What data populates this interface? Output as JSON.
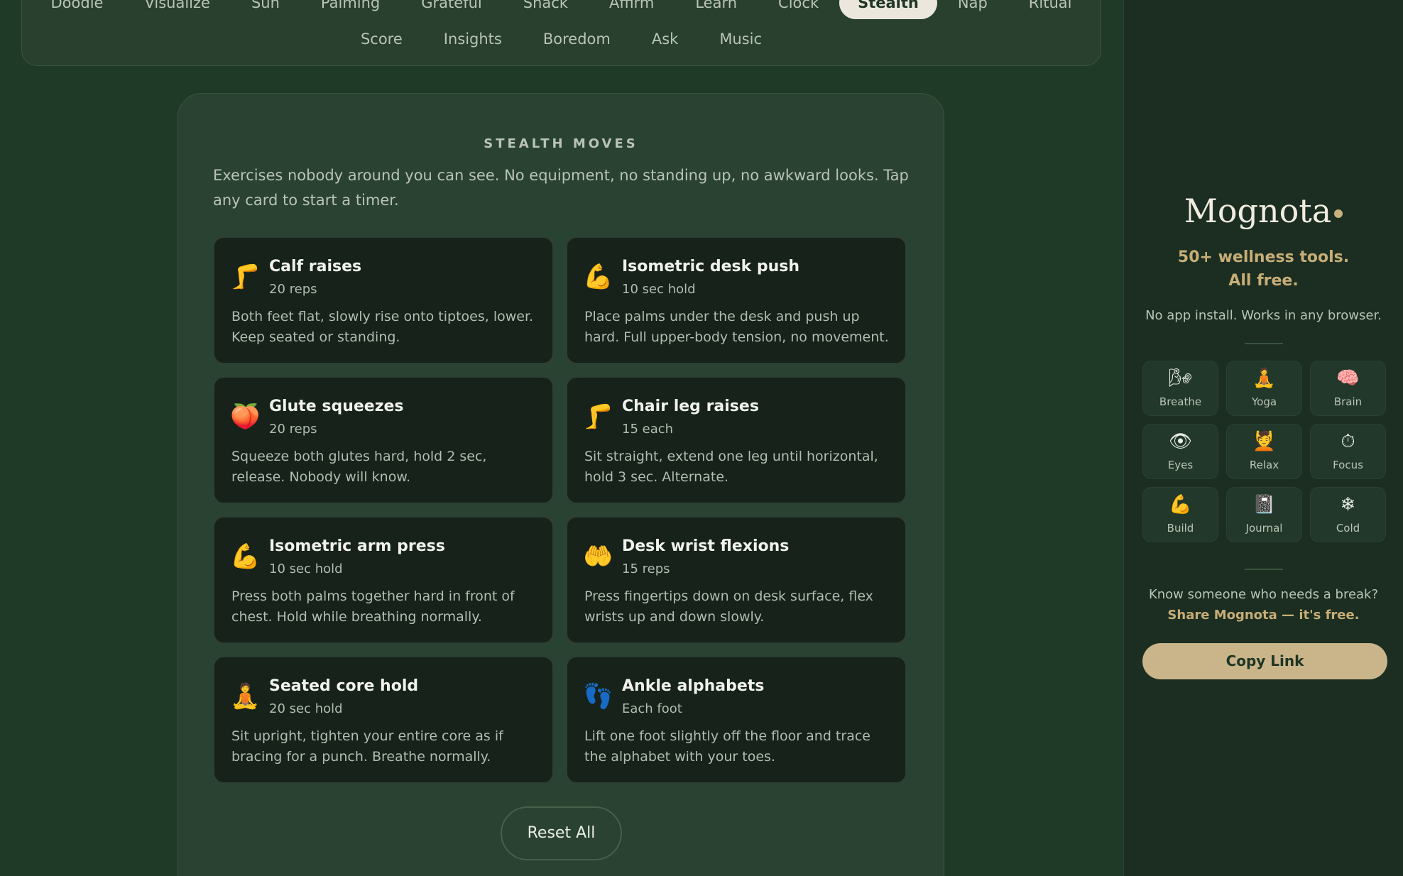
{
  "nav": {
    "row1": [
      "Doodle",
      "Visualize",
      "Sun",
      "Palming",
      "Grateful",
      "Snack",
      "Affirm",
      "Learn",
      "Clock",
      "Stealth",
      "Nap",
      "Ritual"
    ],
    "active": "Stealth",
    "row2": [
      "Score",
      "Insights",
      "Boredom",
      "Ask",
      "Music"
    ]
  },
  "section": {
    "title": "STEALTH MOVES",
    "description": "Exercises nobody around you can see. No equipment, no standing up, no awkward looks. Tap any card to start a timer."
  },
  "cards": [
    {
      "icon": "leg-icon",
      "glyph": "🦵",
      "title": "Calf raises",
      "sub": "20 reps",
      "desc": "Both feet flat, slowly rise onto tiptoes, lower. Keep seated or standing."
    },
    {
      "icon": "flexed-bicep-icon",
      "glyph": "💪",
      "title": "Isometric desk push",
      "sub": "10 sec hold",
      "desc": "Place palms under the desk and push up hard. Full upper-body tension, no movement."
    },
    {
      "icon": "peach-icon",
      "glyph": "🍑",
      "title": "Glute squeezes",
      "sub": "20 reps",
      "desc": "Squeeze both glutes hard, hold 2 sec, release. Nobody will know."
    },
    {
      "icon": "leg-icon",
      "glyph": "🦵",
      "title": "Chair leg raises",
      "sub": "15 each",
      "desc": "Sit straight, extend one leg until horizontal, hold 3 sec. Alternate."
    },
    {
      "icon": "flexed-bicep-icon",
      "glyph": "💪",
      "title": "Isometric arm press",
      "sub": "10 sec hold",
      "desc": "Press both palms together hard in front of chest. Hold while breathing normally."
    },
    {
      "icon": "palms-up-icon",
      "glyph": "🤲",
      "title": "Desk wrist flexions",
      "sub": "15 reps",
      "desc": "Press fingertips down on desk surface, flex wrists up and down slowly."
    },
    {
      "icon": "lotus-person-icon",
      "glyph": "🧘",
      "title": "Seated core hold",
      "sub": "20 sec hold",
      "desc": "Sit upright, tighten your entire core as if bracing for a punch. Breathe normally."
    },
    {
      "icon": "footprints-icon",
      "glyph": "👣",
      "title": "Ankle alphabets",
      "sub": "Each foot",
      "desc": "Lift one foot slightly off the floor and trace the alphabet with your toes."
    }
  ],
  "reset_label": "Reset All",
  "sidebar": {
    "brand": "Mognota",
    "tagline_1": "50+ wellness tools.",
    "tagline_2": "All free.",
    "subtag": "No app install. Works in any browser.",
    "tools": [
      {
        "icon": "breathe-icon",
        "glyph": "🌬",
        "label": "Breathe"
      },
      {
        "icon": "yoga-icon",
        "glyph": "🧘",
        "label": "Yoga"
      },
      {
        "icon": "brain-icon",
        "glyph": "🧠",
        "label": "Brain"
      },
      {
        "icon": "eye-icon",
        "glyph": "👁",
        "label": "Eyes"
      },
      {
        "icon": "relax-icon",
        "glyph": "💆",
        "label": "Relax"
      },
      {
        "icon": "stopwatch-icon",
        "glyph": "⏱",
        "label": "Focus"
      },
      {
        "icon": "flexed-bicep-icon",
        "glyph": "💪",
        "label": "Build"
      },
      {
        "icon": "notebook-icon",
        "glyph": "📓",
        "label": "Journal"
      },
      {
        "icon": "snowflake-icon",
        "glyph": "❄",
        "label": "Cold"
      }
    ],
    "share_question": "Know someone who needs a break?",
    "share_link": "Share Mognota — it's free.",
    "copy_label": "Copy Link"
  },
  "colors": {
    "background": "#203a28",
    "card": "#16221a",
    "accent_gold": "#c7ad77",
    "button_gold": "#c9b589"
  }
}
